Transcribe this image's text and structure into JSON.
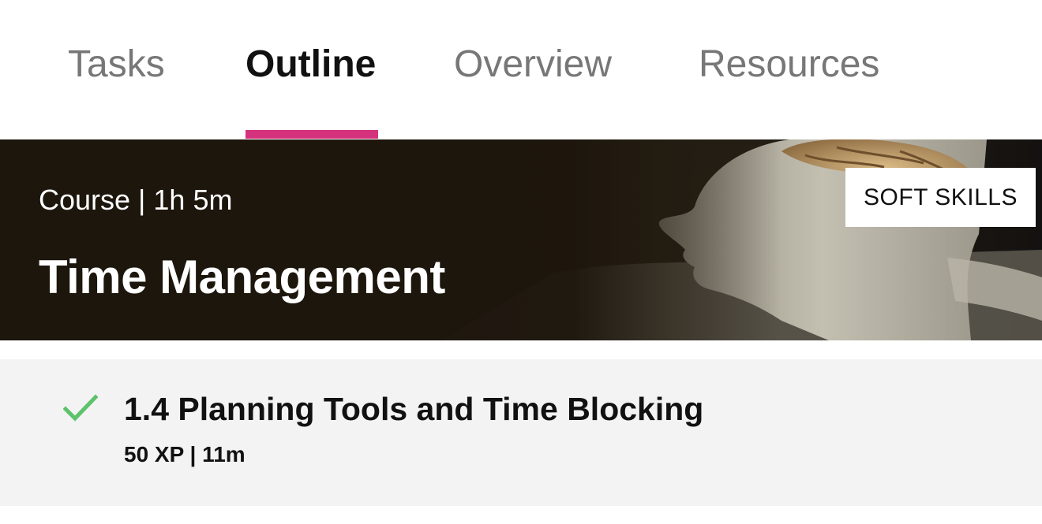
{
  "tabs": {
    "items": [
      {
        "label": "Tasks"
      },
      {
        "label": "Outline"
      },
      {
        "label": "Overview"
      },
      {
        "label": "Resources"
      }
    ],
    "active": "Outline",
    "accent_color": "#d4327d"
  },
  "banner": {
    "meta": "Course | 1h 5m",
    "title": "Time Management",
    "category": "SOFT SKILLS"
  },
  "lesson": {
    "status_icon": "check-icon",
    "status_color": "#5cc26b",
    "title": "1.4 Planning Tools and Time Blocking",
    "meta": "50 XP | 11m"
  }
}
